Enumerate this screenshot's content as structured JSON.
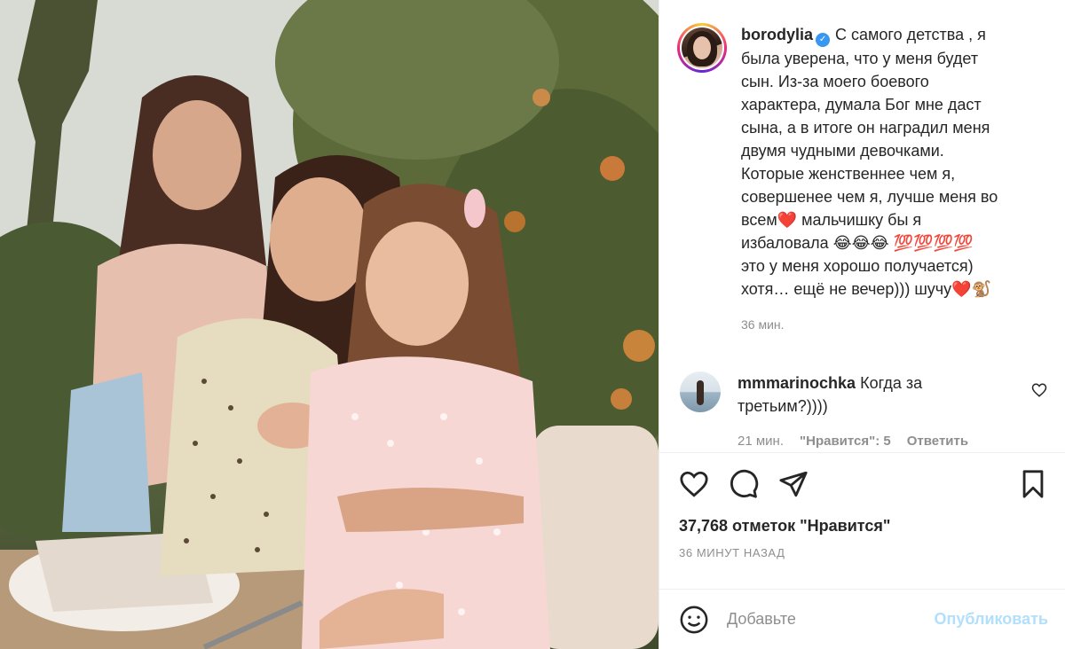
{
  "post": {
    "author": "borodylia",
    "caption_lines": [
      "С самого детства , я",
      "была уверена, что у меня будет",
      "сын. Из-за моего боевого",
      "характера, думала Бог мне даст",
      "сына, а в итоге он наградил меня",
      "двумя чудными девочками.",
      "Которые женственнее чем я,",
      "совершенее чем я, лучше меня во",
      "всем❤️ мальчишку бы я",
      "избаловала 😂😂😂 💯💯💯💯",
      "это у меня хорошо получается)",
      "хотя… ещё не вечер))) шучу❤️🐒"
    ],
    "caption_time": "36 мин."
  },
  "comment": {
    "username": "mmmarinochka",
    "text_lines": [
      "Когда за",
      "третьим?))))"
    ],
    "time": "21 мин.",
    "likes": "\"Нравится\": 5",
    "reply": "Ответить"
  },
  "likes_text": "37,768 отметок \"Нравится\"",
  "time_ago": "36 МИНУТ НАЗАД",
  "add_comment": {
    "placeholder": "Добавьте",
    "publish": "Опубликовать"
  },
  "icons": {
    "like": "heart-icon",
    "comment": "comment-bubble-icon",
    "share": "paper-plane-icon",
    "save": "bookmark-icon",
    "emoji": "smiley-icon",
    "verified": "verified-badge-icon"
  },
  "colors": {
    "verified": "#3897f0",
    "muted": "#8e8e8e",
    "publish_disabled": "#b2dffc"
  }
}
